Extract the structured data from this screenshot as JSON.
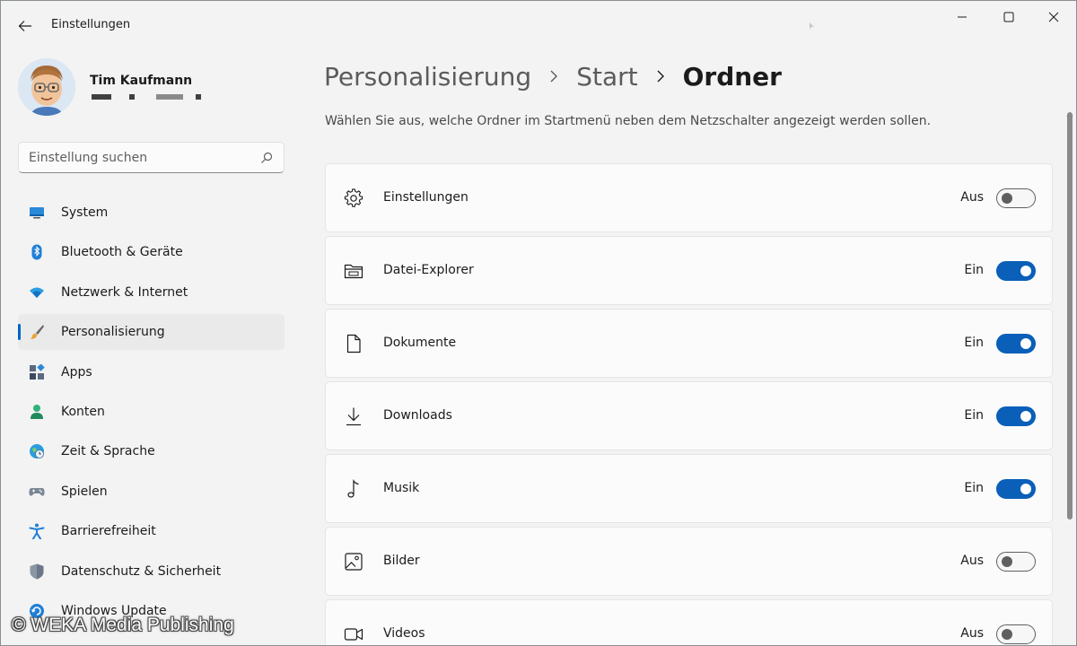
{
  "window": {
    "title": "Einstellungen"
  },
  "profile": {
    "name": "Tim Kaufmann"
  },
  "search": {
    "placeholder": "Einstellung suchen"
  },
  "sidebar": {
    "items": [
      {
        "label": "System",
        "icon": "monitor-icon"
      },
      {
        "label": "Bluetooth & Geräte",
        "icon": "bluetooth-icon"
      },
      {
        "label": "Netzwerk & Internet",
        "icon": "wifi-icon"
      },
      {
        "label": "Personalisierung",
        "icon": "brush-icon",
        "active": true
      },
      {
        "label": "Apps",
        "icon": "apps-icon"
      },
      {
        "label": "Konten",
        "icon": "person-icon"
      },
      {
        "label": "Zeit & Sprache",
        "icon": "globe-clock-icon"
      },
      {
        "label": "Spielen",
        "icon": "gamepad-icon"
      },
      {
        "label": "Barrierefreiheit",
        "icon": "accessibility-icon"
      },
      {
        "label": "Datenschutz & Sicherheit",
        "icon": "shield-icon"
      },
      {
        "label": "Windows Update",
        "icon": "update-icon"
      }
    ]
  },
  "breadcrumb": {
    "items": [
      "Personalisierung",
      "Start"
    ],
    "current": "Ordner"
  },
  "description": "Wählen Sie aus, welche Ordner im Startmenü neben dem Netzschalter angezeigt werden sollen.",
  "folders": [
    {
      "label": "Einstellungen",
      "state": "Aus",
      "on": false,
      "icon": "gear-icon"
    },
    {
      "label": "Datei-Explorer",
      "state": "Ein",
      "on": true,
      "icon": "folder-icon"
    },
    {
      "label": "Dokumente",
      "state": "Ein",
      "on": true,
      "icon": "document-icon"
    },
    {
      "label": "Downloads",
      "state": "Ein",
      "on": true,
      "icon": "download-icon"
    },
    {
      "label": "Musik",
      "state": "Ein",
      "on": true,
      "icon": "music-note-icon"
    },
    {
      "label": "Bilder",
      "state": "Aus",
      "on": false,
      "icon": "image-icon"
    },
    {
      "label": "Videos",
      "state": "Aus",
      "on": false,
      "icon": "video-icon"
    }
  ],
  "watermark": "© WEKA Media Publishing",
  "colors": {
    "accent": "#0a5fb8",
    "background": "#f3f3f3",
    "card": "#fbfbfb"
  }
}
